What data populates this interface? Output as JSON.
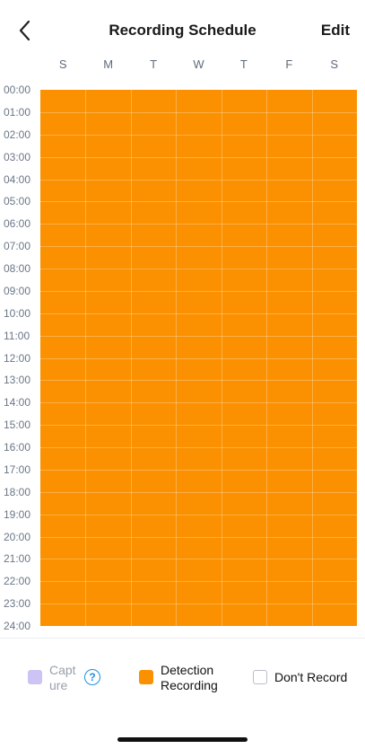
{
  "header": {
    "title": "Recording Schedule",
    "edit_label": "Edit"
  },
  "days": [
    "S",
    "M",
    "T",
    "W",
    "T",
    "F",
    "S"
  ],
  "hours": [
    "00:00",
    "01:00",
    "02:00",
    "03:00",
    "04:00",
    "05:00",
    "06:00",
    "07:00",
    "08:00",
    "09:00",
    "10:00",
    "11:00",
    "12:00",
    "13:00",
    "14:00",
    "15:00",
    "16:00",
    "17:00",
    "18:00",
    "19:00",
    "20:00",
    "21:00",
    "22:00",
    "23:00",
    "24:00"
  ],
  "schedule": {
    "mode_all_cells": "Detection Recording"
  },
  "legend": {
    "capture_label": "Capture",
    "detection_label": "Detection Recording",
    "dont_record_label": "Don't Record"
  },
  "colors": {
    "detection": "#fb9100",
    "capture": "#cdc3f5",
    "help": "#1e8fe0"
  }
}
